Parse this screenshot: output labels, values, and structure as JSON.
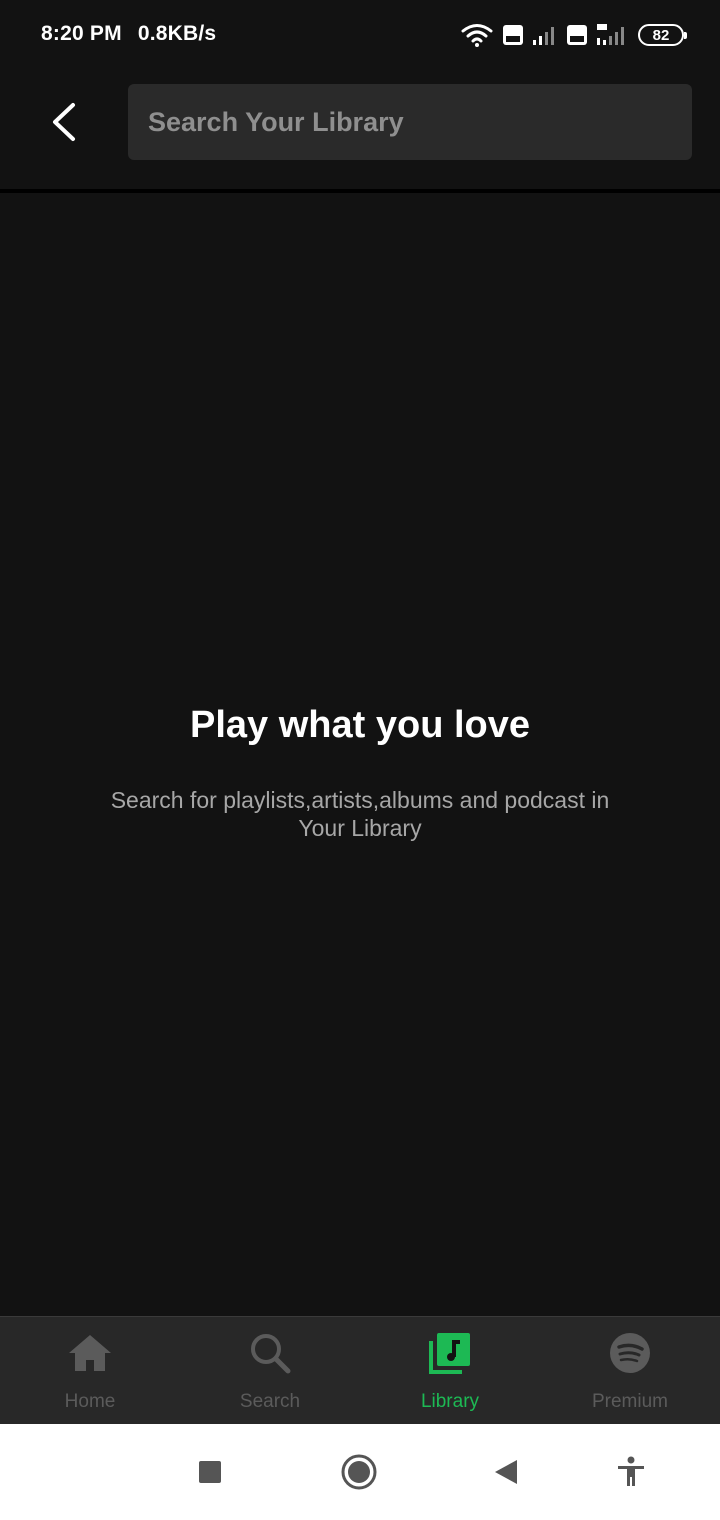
{
  "status_bar": {
    "time": "8:20 PM",
    "speed": "0.8KB/s",
    "battery": "82",
    "icons": [
      "wifi-icon",
      "volte-icon",
      "signal-icon",
      "volte-icon",
      "4g-signal-icon",
      "battery-icon"
    ]
  },
  "header": {
    "back_icon": "chevron-left-icon",
    "search_placeholder": "Search Your Library"
  },
  "empty_state": {
    "title": "Play what you love",
    "subtitle": "Search for playlists,artists,albums and podcast in Your Library"
  },
  "bottom_nav": {
    "active": "Library",
    "active_color": "#1db954",
    "inactive_color": "#5b5b5b",
    "items": [
      {
        "label": "Home",
        "icon": "home-icon"
      },
      {
        "label": "Search",
        "icon": "search-icon"
      },
      {
        "label": "Library",
        "icon": "library-icon"
      },
      {
        "label": "Premium",
        "icon": "spotify-icon"
      }
    ]
  },
  "system_nav": {
    "icons": [
      "recents-square-icon",
      "home-circle-icon",
      "back-triangle-icon",
      "accessibility-icon"
    ]
  },
  "colors": {
    "background": "#121212",
    "search_field": "#2a2a2a",
    "nav_background": "#282828",
    "subtitle_text": "#a7a7a7"
  }
}
